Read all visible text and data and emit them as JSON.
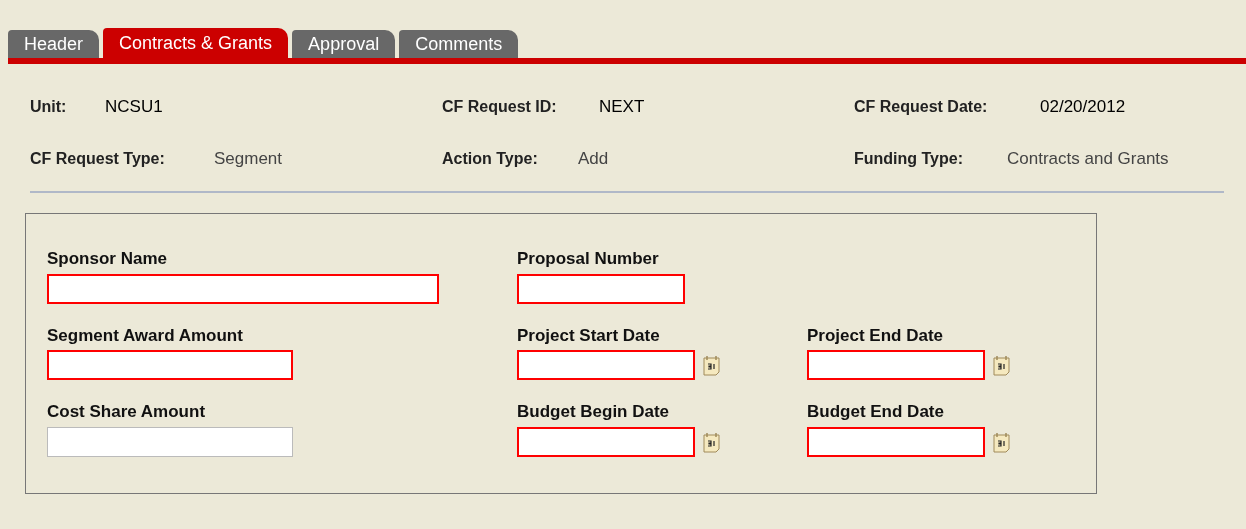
{
  "tabs": [
    {
      "label": "Header",
      "selected": false
    },
    {
      "label": "Contracts & Grants",
      "selected": true
    },
    {
      "label": "Approval",
      "selected": false
    },
    {
      "label": "Comments",
      "selected": false
    }
  ],
  "summary": [
    {
      "label": "Unit:",
      "value": "NCSU1"
    },
    {
      "label": "CF Request ID:",
      "value": "NEXT"
    },
    {
      "label": "CF Request Date:",
      "value": "02/20/2012"
    },
    {
      "label": "CF Request Type:",
      "value": "Segment"
    },
    {
      "label": "Action Type:",
      "value": "Add"
    },
    {
      "label": "Funding Type:",
      "value": "Contracts and Grants"
    }
  ],
  "form_rows": [
    {
      "fields": [
        {
          "label": "Sponsor Name",
          "kind": "long",
          "required": true
        },
        {
          "label": "Proposal Number",
          "kind": "short",
          "required": true
        }
      ]
    },
    {
      "fields": [
        {
          "label": "Segment Award Amount",
          "kind": "medium",
          "required": true
        },
        {
          "label": "Project Start Date",
          "kind": "date",
          "required": true
        },
        {
          "label": "Project End Date",
          "kind": "date",
          "required": true
        }
      ]
    },
    {
      "fields": [
        {
          "label": "Cost Share Amount",
          "kind": "medium",
          "required": false
        },
        {
          "label": "Budget Begin Date",
          "kind": "date",
          "required": true
        },
        {
          "label": "Budget End Date",
          "kind": "date",
          "required": true
        }
      ]
    }
  ]
}
